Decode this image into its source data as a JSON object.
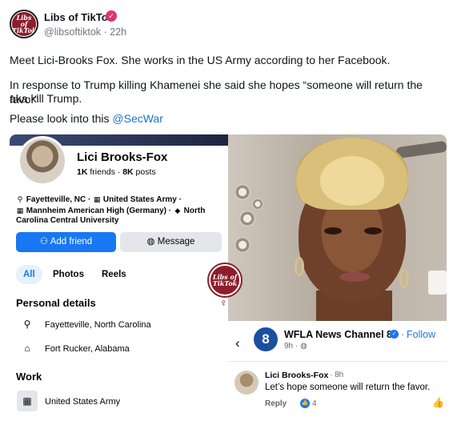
{
  "post": {
    "author_name": "Libs of TikTok",
    "avatar_text_1": "Libs of",
    "avatar_text_2": "TikTok",
    "handle": "@libsoftiktok",
    "time_sep": "·",
    "time": "22h",
    "line1": "Meet Lici-Brooks Fox. She works in the US Army according to her Facebook.",
    "line2a": "In response to Trump killing Khamenei she said she hopes “someone will return the favor”",
    "line2b": "aka kill Trump.",
    "line3_text": "Please look into this ",
    "line3_mention": "@SecWar"
  },
  "fb_profile": {
    "name": "Lici Brooks-Fox",
    "friends_count": "1K",
    "friends_label": " friends · ",
    "posts_count": "8K",
    "posts_label": " posts",
    "info_line1": "Fayetteville, NC · ",
    "info_employer": "United States Army ·",
    "info_line2": "Mannheim American High  (Germany) · ",
    "info_school": "North",
    "info_line3": "Carolina Central University",
    "add_friend": "Add friend",
    "message": "Message",
    "tabs": [
      "All",
      "Photos",
      "Reels"
    ],
    "personal_heading": "Personal details",
    "lives_in": "Fayetteville, North Carolina",
    "from": "Fort Rucker, Alabama",
    "work_heading": "Work",
    "employer": "United States Army"
  },
  "watermark": {
    "text_1": "Libs of",
    "text_2": "TikTok"
  },
  "wfla": {
    "logo_text": "8",
    "page_name": "WFLA News Channel 8",
    "dot": "·",
    "follow": "Follow",
    "meta": "9h · ",
    "comment_author": "Lici Brooks-Fox",
    "comment_time": "· 8h",
    "comment_text": "Let’s hope someone will return the favor.",
    "reply": "Reply",
    "reaction_count": "4"
  },
  "colors": {
    "accent_blue": "#1877f2",
    "mention_blue": "#1d72c8",
    "brand_red": "#8b1e2c",
    "verified_pink": "#d9376e"
  }
}
